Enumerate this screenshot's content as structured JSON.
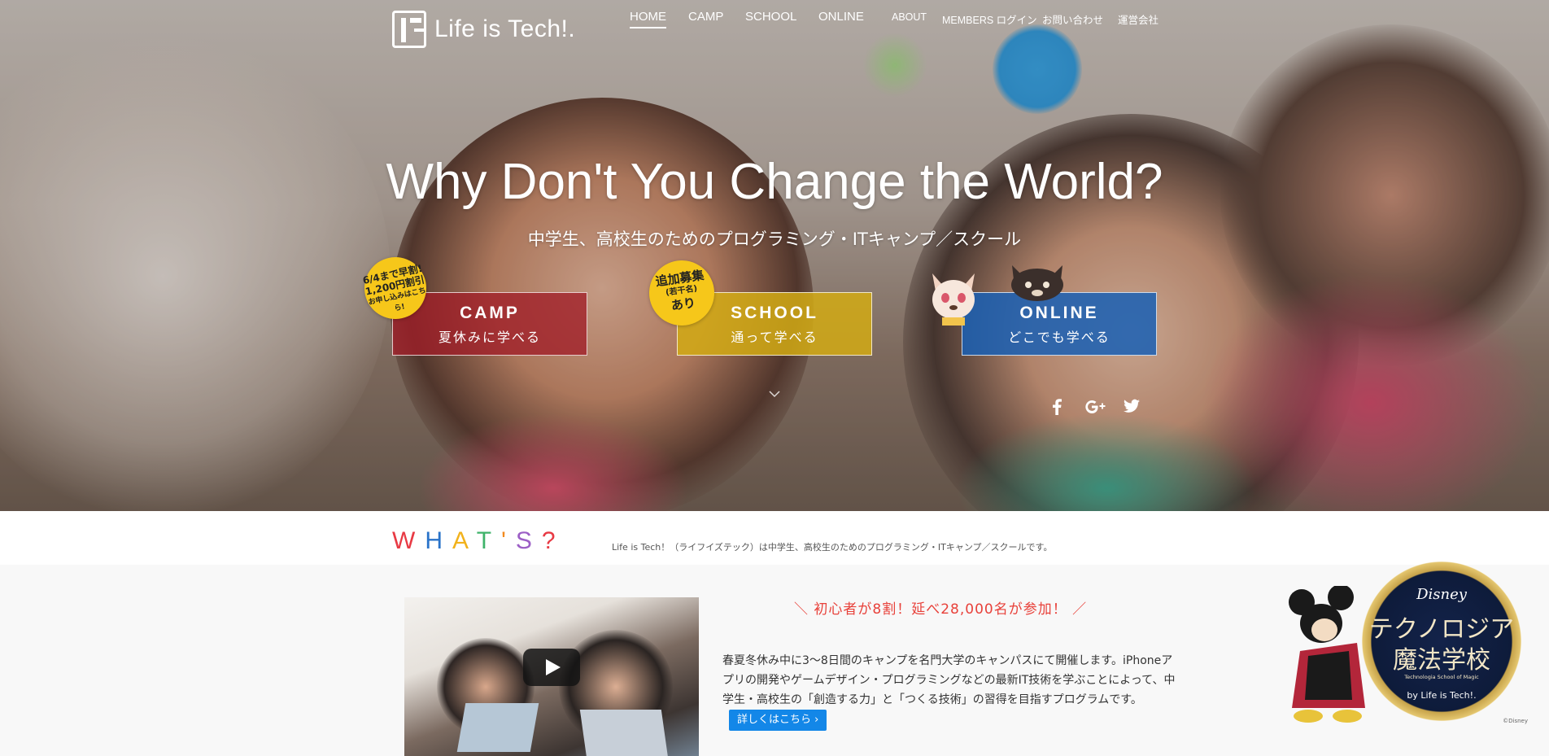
{
  "brand": {
    "name": "Life is Tech!."
  },
  "nav": {
    "items": [
      {
        "label": "HOME",
        "active": true
      },
      {
        "label": "CAMP"
      },
      {
        "label": "SCHOOL"
      },
      {
        "label": "ONLINE"
      },
      {
        "label": "ABOUT"
      },
      {
        "label": "MEMBERS ログイン"
      },
      {
        "label": "お問い合わせ"
      },
      {
        "label": "運営会社"
      }
    ]
  },
  "hero": {
    "title": "Why Don't You Change the World?",
    "subtitle": "中学生、高校生のためのプログラミング・ITキャンプ／スクール"
  },
  "cta": {
    "camp": {
      "title": "CAMP",
      "subtitle": "夏休みに学べる",
      "color": "#a01e28"
    },
    "school": {
      "title": "SCHOOL",
      "subtitle": "通って学べる",
      "color": "#d2aa14"
    },
    "online": {
      "title": "ONLINE",
      "subtitle": "どこでも学べる",
      "color": "#195fb4"
    }
  },
  "badges": {
    "camp": {
      "line1": "6/4まで早割!",
      "line2": "1,200円割引",
      "line3": "お申し込みはこちら!"
    },
    "school": {
      "line1": "追加募集",
      "line2": "(若干名)",
      "line3": "あり"
    }
  },
  "icons": {
    "scroll": "chevron-down-icon",
    "social": [
      "facebook-icon",
      "google-plus-icon",
      "twitter-icon"
    ],
    "video_play": "play-icon"
  },
  "whats": {
    "title_letters": [
      "W",
      "H",
      "A",
      "T",
      "'",
      "S",
      "?"
    ],
    "description": "Life is Tech！（ライフイズテック）は中学生、高校生のためのプログラミング・ITキャンプ／スクールです。"
  },
  "content": {
    "highlight": "＼ 初心者が8割！延べ28,000名が参加！ ／",
    "body": "春夏冬休み中に3〜8日間のキャンプを名門大学のキャンパスにて開催します。iPhoneアプリの開発やゲームデザイン・プログラミングなどの最新IT技術を学ぶことによって、中学生・高校生の「創造する力」と「つくる技術」の習得を目指すプログラムです。",
    "more_button": "詳しくはこちら ›"
  },
  "disney": {
    "brand": "Disney",
    "line1": "テクノロジア",
    "line2": "魔法学校",
    "line3": "Technologia School of Magic",
    "line4": "by Life is Tech!.",
    "copyright": "©Disney"
  }
}
